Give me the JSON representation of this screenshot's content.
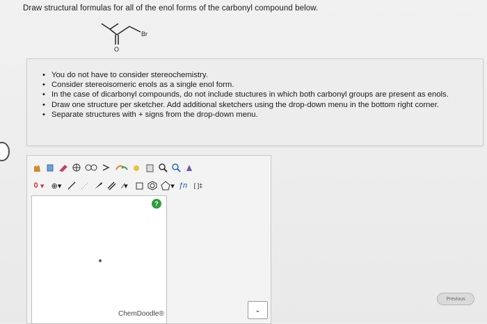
{
  "question": "Draw structural formulas for all of the enol forms of the carbonyl compound below.",
  "molecule": {
    "br_label": "Br",
    "o_label": "O"
  },
  "instructions": [
    "You do not have to consider stereochemistry.",
    "Consider stereoisomeric enols as a single enol form.",
    "In the case of dicarbonyl compounds, do not include stuctures in which both carbonyl groups are present as enols.",
    "Draw one structure per sketcher. Add additional sketchers using the drop-down menu in the bottom right corner.",
    "Separate structures with + signs from the drop-down menu."
  ],
  "sketcher": {
    "charge_value": "0",
    "help_label": "?",
    "brand": "ChemDoodle®",
    "fn_label": "ƒn",
    "bracket_label": "[ ]‡"
  },
  "dropdown_arrow": "⌄",
  "previous_label": "Previous"
}
